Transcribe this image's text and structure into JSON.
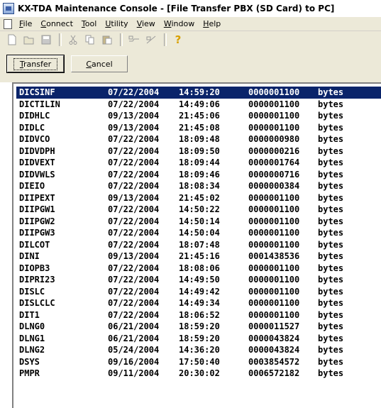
{
  "window": {
    "title": "KX-TDA Maintenance Console - [File Transfer PBX (SD Card) to PC]"
  },
  "menu": {
    "items": [
      {
        "label": "File",
        "accel": "F",
        "rest": "ile"
      },
      {
        "label": "Connect",
        "accel": "C",
        "rest": "onnect"
      },
      {
        "label": "Tool",
        "accel": "T",
        "rest": "ool"
      },
      {
        "label": "Utility",
        "accel": "U",
        "rest": "tility"
      },
      {
        "label": "View",
        "accel": "V",
        "rest": "iew"
      },
      {
        "label": "Window",
        "accel": "W",
        "rest": "indow"
      },
      {
        "label": "Help",
        "accel": "H",
        "rest": "elp"
      }
    ]
  },
  "toolbar": {
    "icons": [
      "new-icon",
      "open-icon",
      "save-icon",
      "cut-icon",
      "copy-icon",
      "paste-icon",
      "connect-icon",
      "disconnect-icon",
      "help-icon"
    ]
  },
  "actions": {
    "transfer_accel": "T",
    "transfer_rest": "ransfer",
    "cancel_accel": "C",
    "cancel_rest": "ancel"
  },
  "files": [
    {
      "name": "DICSINF",
      "date": "07/22/2004",
      "time": "14:59:20",
      "size": "0000001100",
      "unit": "bytes",
      "selected": true
    },
    {
      "name": "DICTILIN",
      "date": "07/22/2004",
      "time": "14:49:06",
      "size": "0000001100",
      "unit": "bytes"
    },
    {
      "name": "DIDHLC",
      "date": "09/13/2004",
      "time": "21:45:06",
      "size": "0000001100",
      "unit": "bytes"
    },
    {
      "name": "DIDLC",
      "date": "09/13/2004",
      "time": "21:45:08",
      "size": "0000001100",
      "unit": "bytes"
    },
    {
      "name": "DIDVCO",
      "date": "07/22/2004",
      "time": "18:09:48",
      "size": "0000000980",
      "unit": "bytes"
    },
    {
      "name": "DIDVDPH",
      "date": "07/22/2004",
      "time": "18:09:50",
      "size": "0000000216",
      "unit": "bytes"
    },
    {
      "name": "DIDVEXT",
      "date": "07/22/2004",
      "time": "18:09:44",
      "size": "0000001764",
      "unit": "bytes"
    },
    {
      "name": "DIDVWLS",
      "date": "07/22/2004",
      "time": "18:09:46",
      "size": "0000000716",
      "unit": "bytes"
    },
    {
      "name": "DIEIO",
      "date": "07/22/2004",
      "time": "18:08:34",
      "size": "0000000384",
      "unit": "bytes"
    },
    {
      "name": "DIIPEXT",
      "date": "09/13/2004",
      "time": "21:45:02",
      "size": "0000001100",
      "unit": "bytes"
    },
    {
      "name": "DIIPGW1",
      "date": "07/22/2004",
      "time": "14:50:22",
      "size": "0000001100",
      "unit": "bytes"
    },
    {
      "name": "DIIPGW2",
      "date": "07/22/2004",
      "time": "14:50:14",
      "size": "0000001100",
      "unit": "bytes"
    },
    {
      "name": "DIIPGW3",
      "date": "07/22/2004",
      "time": "14:50:04",
      "size": "0000001100",
      "unit": "bytes"
    },
    {
      "name": "DILCOT",
      "date": "07/22/2004",
      "time": "18:07:48",
      "size": "0000001100",
      "unit": "bytes"
    },
    {
      "name": "DINI",
      "date": "09/13/2004",
      "time": "21:45:16",
      "size": "0001438536",
      "unit": "bytes"
    },
    {
      "name": "DIOPB3",
      "date": "07/22/2004",
      "time": "18:08:06",
      "size": "0000001100",
      "unit": "bytes"
    },
    {
      "name": "DIPRI23",
      "date": "07/22/2004",
      "time": "14:49:50",
      "size": "0000001100",
      "unit": "bytes"
    },
    {
      "name": "DISLC",
      "date": "07/22/2004",
      "time": "14:49:42",
      "size": "0000001100",
      "unit": "bytes"
    },
    {
      "name": "DISLCLC",
      "date": "07/22/2004",
      "time": "14:49:34",
      "size": "0000001100",
      "unit": "bytes"
    },
    {
      "name": "DIT1",
      "date": "07/22/2004",
      "time": "18:06:52",
      "size": "0000001100",
      "unit": "bytes"
    },
    {
      "name": "DLNG0",
      "date": "06/21/2004",
      "time": "18:59:20",
      "size": "0000011527",
      "unit": "bytes"
    },
    {
      "name": "DLNG1",
      "date": "06/21/2004",
      "time": "18:59:20",
      "size": "0000043824",
      "unit": "bytes"
    },
    {
      "name": "DLNG2",
      "date": "05/24/2004",
      "time": "14:36:20",
      "size": "0000043824",
      "unit": "bytes"
    },
    {
      "name": "DSYS",
      "date": "09/16/2004",
      "time": "17:50:40",
      "size": "0003854572",
      "unit": "bytes"
    },
    {
      "name": "PMPR",
      "date": "09/11/2004",
      "time": "20:30:02",
      "size": "0006572182",
      "unit": "bytes"
    }
  ]
}
